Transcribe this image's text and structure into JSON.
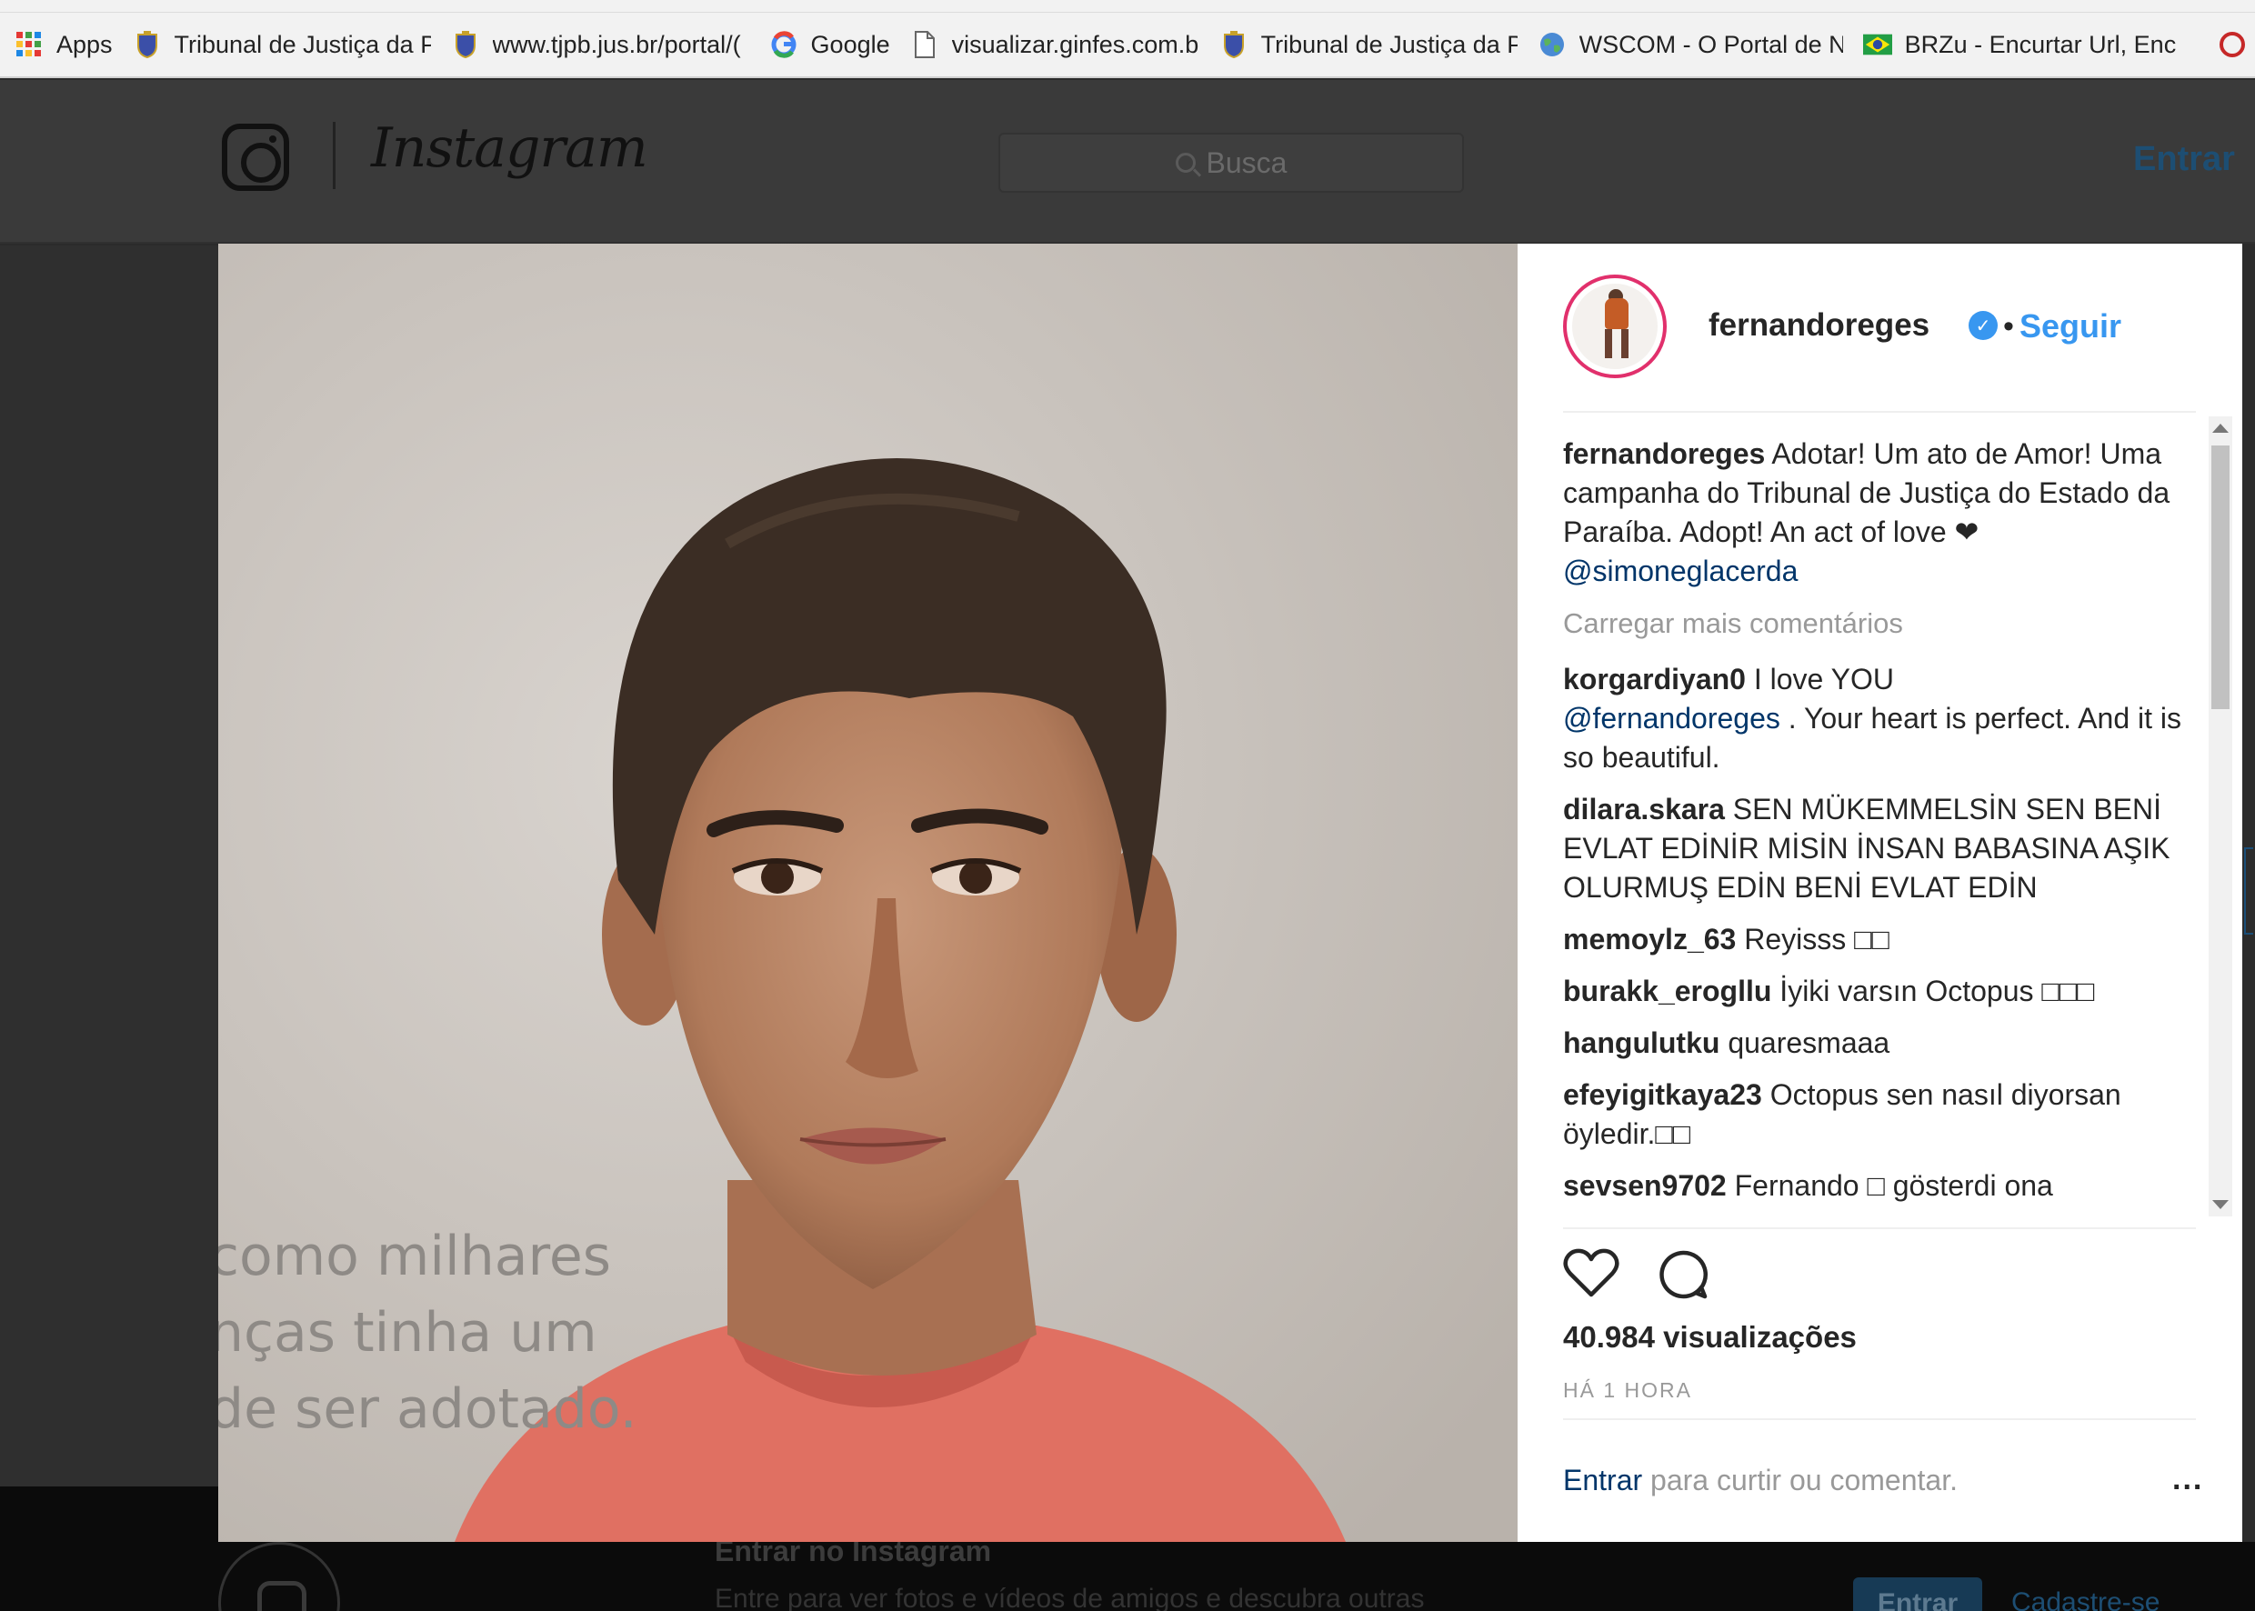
{
  "bookmarks": [
    {
      "icon": "apps-grid-icon",
      "label": "Apps"
    },
    {
      "icon": "tribunal-crest-icon",
      "label": "Tribunal de Justiça da Pa"
    },
    {
      "icon": "tribunal-crest-icon",
      "label": "www.tjpb.jus.br/portal/("
    },
    {
      "icon": "google-icon",
      "label": "Google"
    },
    {
      "icon": "page-icon",
      "label": "visualizar.ginfes.com.br/"
    },
    {
      "icon": "tribunal-crest-icon",
      "label": "Tribunal de Justiça da Pa"
    },
    {
      "icon": "globe-icon",
      "label": "WSCOM - O Portal de No"
    },
    {
      "icon": "brazil-flag-icon",
      "label": "BRZu - Encurtar Url, Enc"
    }
  ],
  "ig_header": {
    "wordmark": "Instagram",
    "search_placeholder": "Busca",
    "login": "Entrar"
  },
  "media": {
    "overlay_lines": [
      "como milhares",
      "nças tinha um",
      "de ser adotado."
    ]
  },
  "post": {
    "username": "fernandoreges",
    "follow": "Seguir",
    "dot": "•",
    "caption_user": "fernandoreges",
    "caption_text": "Adotar! Um ato de Amor! Uma campanha do Tribunal de Justiça do Estado da Paraíba. Adopt! An act of love",
    "caption_heart": "❤",
    "caption_mention": "@simoneglacerda",
    "load_more": "Carregar mais comentários",
    "comments": [
      {
        "user": "korgardiyan0",
        "text": "I love YOU",
        "mention": "@fernandoreges",
        "after": ". Your heart is perfect. And it is so beautiful."
      },
      {
        "user": "dilara.skara",
        "text": "SEN MÜKEMMELSİN SEN BENİ EVLAT EDİNİR MİSİN İNSAN BABASINA AŞIK OLURMUŞ EDİN BENİ EVLAT EDİN"
      },
      {
        "user": "memoylz_63",
        "text": "Reyisss □□"
      },
      {
        "user": "burakk_erogllu",
        "text": "İyiki varsın Octopus □□□"
      },
      {
        "user": "hangulutku",
        "text": "quaresmaaa"
      },
      {
        "user": "efeyigitkaya23",
        "text": "Octopus sen nasıl diyorsan öyledir.□□"
      },
      {
        "user": "sevsen9702",
        "text": "Fernando □ gösterdi ona"
      }
    ],
    "views": "40.984 visualizações",
    "time": "HÁ 1 HORA",
    "login_link": "Entrar",
    "login_text": " para curtir ou comentar.",
    "more": "..."
  },
  "footer": {
    "title": "Entrar no Instagram",
    "subtitle": "Entre para ver fotos e vídeos de amigos e descubra outras",
    "button": "Entrar",
    "link": "Cadastre-se"
  },
  "colors": {
    "accent": "#3897f0",
    "link": "#003569"
  }
}
